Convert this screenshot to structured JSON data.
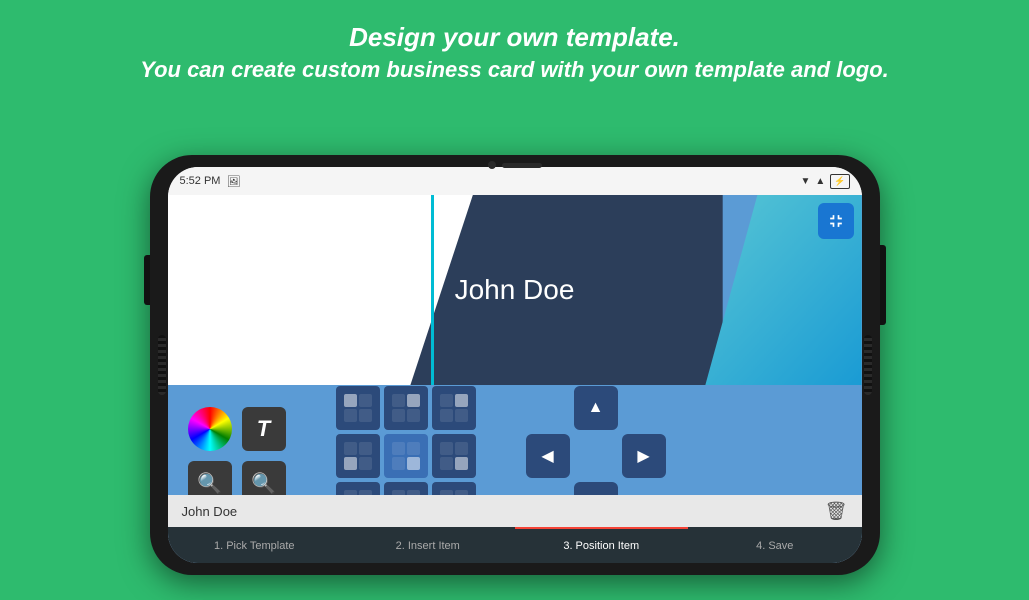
{
  "background_color": "#2ebb6e",
  "header": {
    "line1": "Design your own template.",
    "line2": "You can create custom business card with your own template and logo."
  },
  "status_bar": {
    "time": "5:52 PM",
    "wifi_icon": "wifi",
    "signal_icon": "signal",
    "battery_icon": "battery"
  },
  "card": {
    "name": "John Doe"
  },
  "info_bar": {
    "item_name": "John Doe",
    "trash_label": "delete"
  },
  "nav_tabs": [
    {
      "id": "pick-template",
      "label": "1. Pick Template",
      "active": false
    },
    {
      "id": "insert-item",
      "label": "2. Insert Item",
      "active": false
    },
    {
      "id": "position-item",
      "label": "3. Position Item",
      "active": true
    },
    {
      "id": "save",
      "label": "4. Save",
      "active": false
    }
  ],
  "tools": {
    "color_wheel": "🎨",
    "text": "T",
    "zoom_in": "+",
    "zoom_out": "-"
  },
  "arrows": {
    "up": "▲",
    "down": "▼",
    "left": "◀",
    "right": "▶"
  }
}
